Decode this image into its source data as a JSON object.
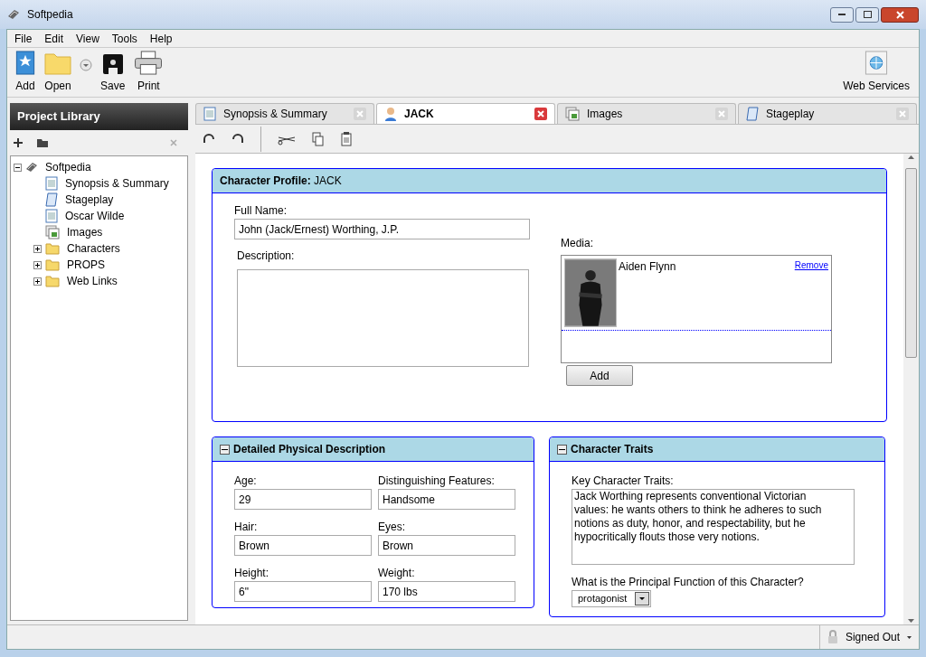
{
  "window": {
    "title": "Softpedia"
  },
  "menu": [
    "File",
    "Edit",
    "View",
    "Tools",
    "Help"
  ],
  "toolbar": {
    "left": [
      {
        "kind": "add",
        "label": "Add"
      },
      {
        "kind": "open",
        "label": "Open"
      },
      {
        "kind": "save",
        "label": "Save"
      },
      {
        "kind": "print",
        "label": "Print"
      }
    ],
    "right": [
      {
        "kind": "web",
        "label": "Web Services"
      }
    ]
  },
  "sidebar": {
    "title": "Project Library",
    "tree": [
      {
        "label": "Softpedia",
        "kind": "project",
        "expanded": true,
        "children": [
          {
            "label": "Synopsis & Summary",
            "kind": "doc"
          },
          {
            "label": "Stageplay",
            "kind": "script"
          },
          {
            "label": "Oscar Wilde",
            "kind": "doc"
          },
          {
            "label": "Images",
            "kind": "images"
          },
          {
            "label": "Characters",
            "kind": "folder",
            "expanded": false
          },
          {
            "label": "PROPS",
            "kind": "folder",
            "expanded": false
          },
          {
            "label": "Web Links",
            "kind": "folder",
            "expanded": false
          }
        ]
      }
    ]
  },
  "tabs": [
    {
      "label": "Synopsis & Summary",
      "kind": "doc",
      "selected": false
    },
    {
      "label": "JACK",
      "kind": "person",
      "selected": true
    },
    {
      "label": "Images",
      "kind": "images",
      "selected": false
    },
    {
      "label": "Stageplay",
      "kind": "script",
      "selected": false
    }
  ],
  "profile": {
    "title": "Character Profile:",
    "name": "JACK",
    "full_name_label": "Full Name:",
    "full_name": "John (Jack/Ernest) Worthing, J.P.",
    "description_label": "Description:",
    "media_label": "Media:",
    "media": [
      {
        "name": "Aiden Flynn",
        "link": "Remove"
      }
    ],
    "add_button": "Add"
  },
  "physical": {
    "title": "Detailed Physical Description",
    "fields": [
      {
        "label": "Age:",
        "value": "29"
      },
      {
        "label": "Distinguishing Features:",
        "value": "Handsome"
      },
      {
        "label": "Hair:",
        "value": "Brown"
      },
      {
        "label": "Eyes:",
        "value": "Brown"
      },
      {
        "label": "Height:",
        "value": "6\""
      },
      {
        "label": "Weight:",
        "value": "170 lbs"
      }
    ]
  },
  "traits": {
    "title": "Character Traits",
    "key_label": "Key Character Traits:",
    "key_value": "Jack Worthing represents conventional Victorian values: he wants others to think he adheres to such notions as duty, honor, and respectability, but he hypocritically flouts those very notions.",
    "function_label": "What is the Principal Function of this Character?",
    "function_value": "protagonist"
  },
  "status": {
    "user": "Signed Out"
  }
}
